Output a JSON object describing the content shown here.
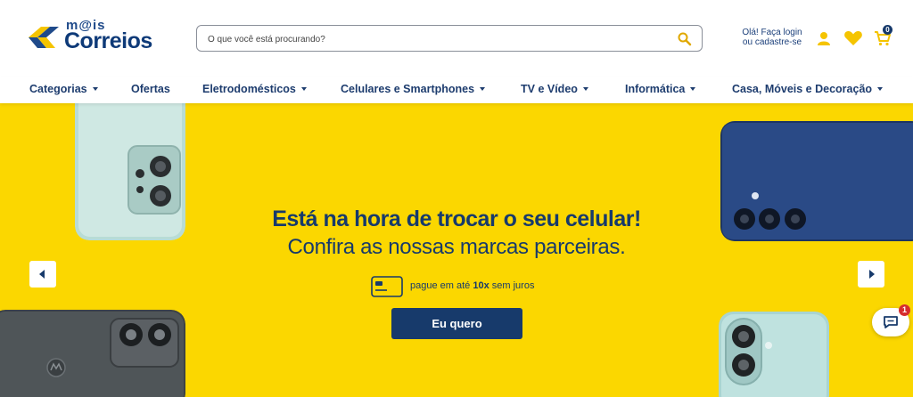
{
  "brand": {
    "mais": "m@is",
    "name": "Correios"
  },
  "search": {
    "placeholder": "O que você está procurando?",
    "icon": "search-icon"
  },
  "account": {
    "login_label": "Olá! Faça login ou cadastre-se",
    "icons": [
      "user-icon",
      "heart-icon",
      "cart-icon"
    ],
    "cart_count": "0"
  },
  "nav": {
    "items": [
      {
        "label": "Categorias",
        "has_dropdown": true
      },
      {
        "label": "Ofertas",
        "has_dropdown": false
      },
      {
        "label": "Eletrodomésticos",
        "has_dropdown": true
      },
      {
        "label": "Celulares e Smartphones",
        "has_dropdown": true
      },
      {
        "label": "TV e Vídeo",
        "has_dropdown": true
      },
      {
        "label": "Informática",
        "has_dropdown": true
      },
      {
        "label": "Casa, Móveis e Decoração",
        "has_dropdown": true
      }
    ]
  },
  "banner": {
    "headline": "Está na hora de trocar o seu celular!",
    "subline": "Confira as nossas marcas parceiras.",
    "payment_prefix": "pague em até",
    "payment_bold": "10x",
    "payment_suffix": "sem juros",
    "cta_label": "Eu quero",
    "icon": "credit-card-icon"
  },
  "chat": {
    "badge_count": "1",
    "icon": "chat-icon"
  },
  "colors": {
    "brand_blue": "#173a6b",
    "banner_yellow": "#fbd700",
    "accent_yellow": "#f5c400",
    "badge_red": "#d62d2d"
  }
}
